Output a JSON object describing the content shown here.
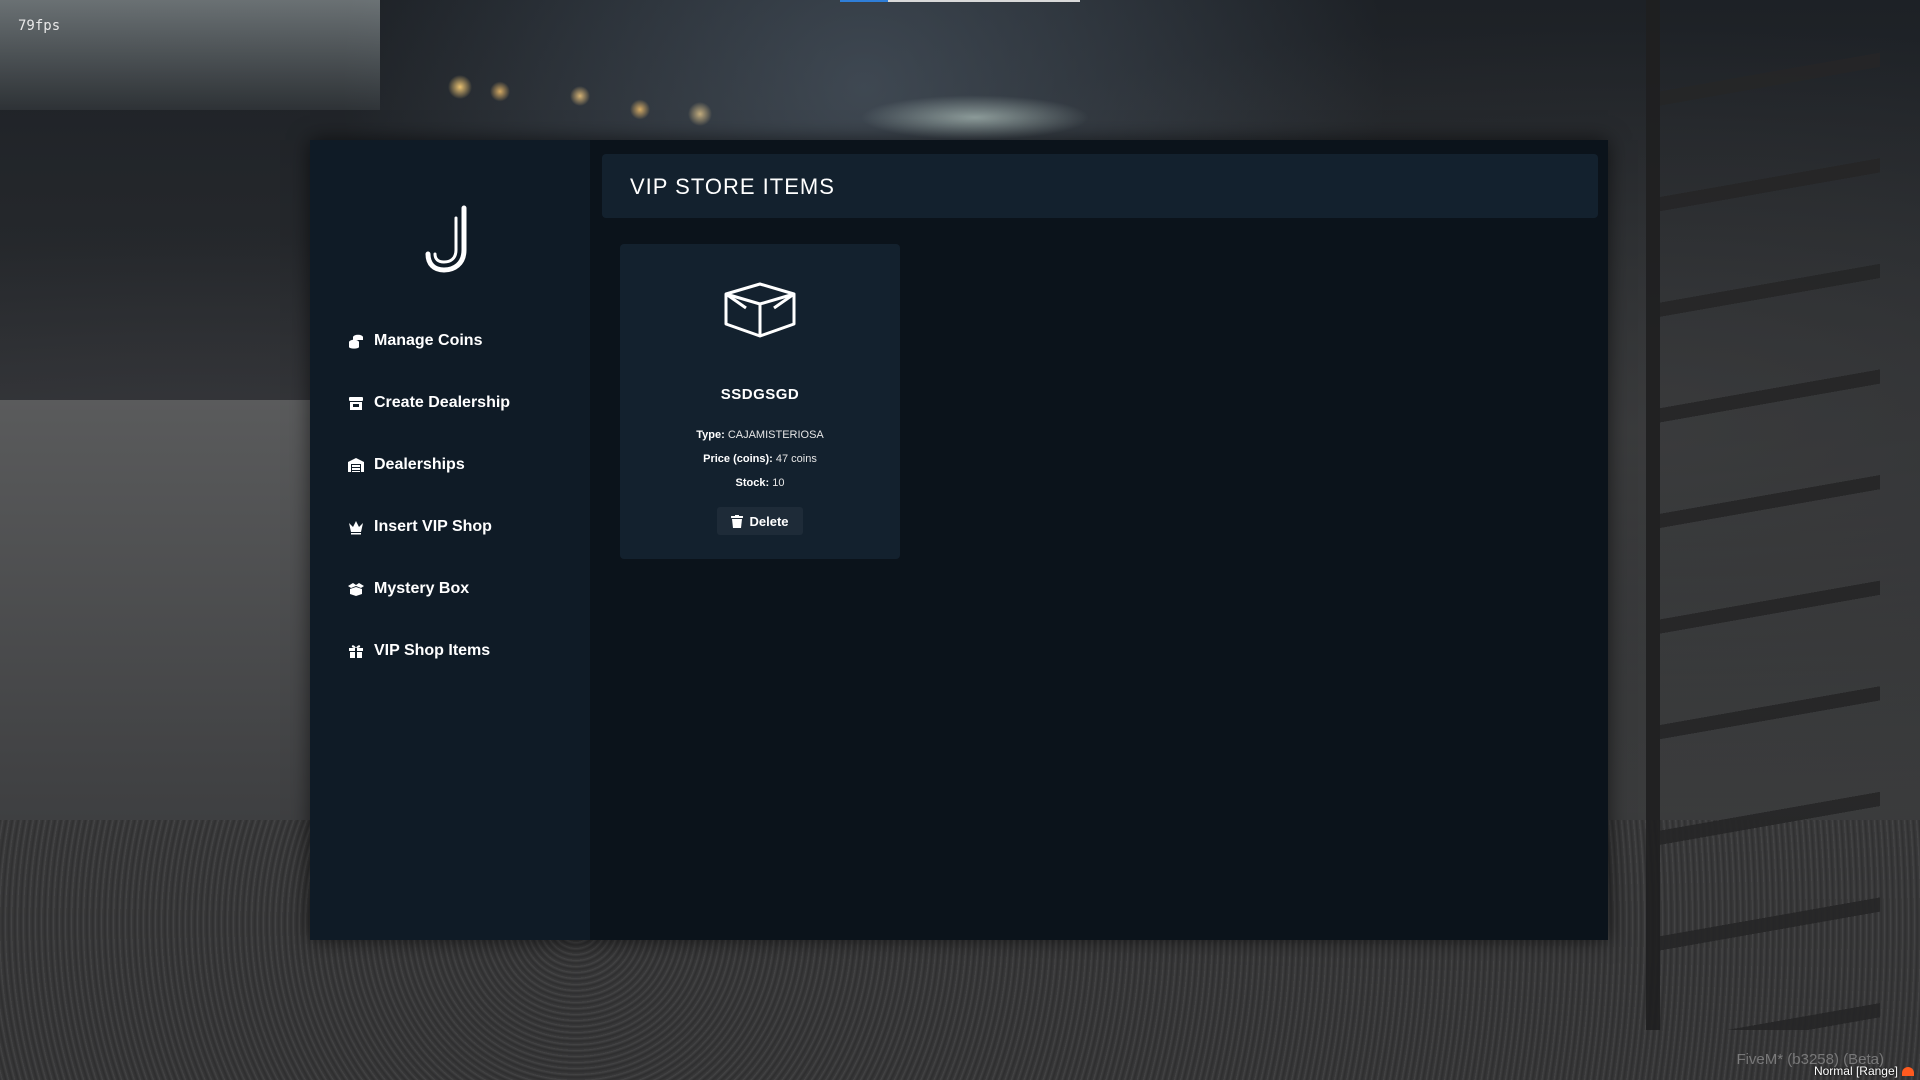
{
  "hud": {
    "fps": "79fps",
    "client": "FiveM* (b3258) (Beta)",
    "voice_mode": "Normal [Range]"
  },
  "sidebar": {
    "logo_icon": "j-logo-icon",
    "items": [
      {
        "label": "Manage Coins",
        "icon": "coins-icon"
      },
      {
        "label": "Create Dealership",
        "icon": "store-icon"
      },
      {
        "label": "Dealerships",
        "icon": "warehouse-icon"
      },
      {
        "label": "Insert VIP Shop",
        "icon": "crown-icon"
      },
      {
        "label": "Mystery Box",
        "icon": "box-open-icon"
      },
      {
        "label": "VIP Shop Items",
        "icon": "gift-icon"
      }
    ]
  },
  "main": {
    "title": "VIP STORE ITEMS",
    "items": [
      {
        "icon": "box-icon",
        "name": "SSDGSGD",
        "type_label": "Type:",
        "type_value": "CAJAMISTERIOSA",
        "price_label": "Price (coins):",
        "price_value": "47 coins",
        "stock_label": "Stock:",
        "stock_value": "10",
        "delete_label": "Delete"
      }
    ]
  },
  "colors": {
    "panel_bg": "#0b131b",
    "sidebar_bg": "#0f1b26",
    "card_bg": "#13212e",
    "button_bg": "#1e2b38",
    "text": "#ffffff"
  }
}
